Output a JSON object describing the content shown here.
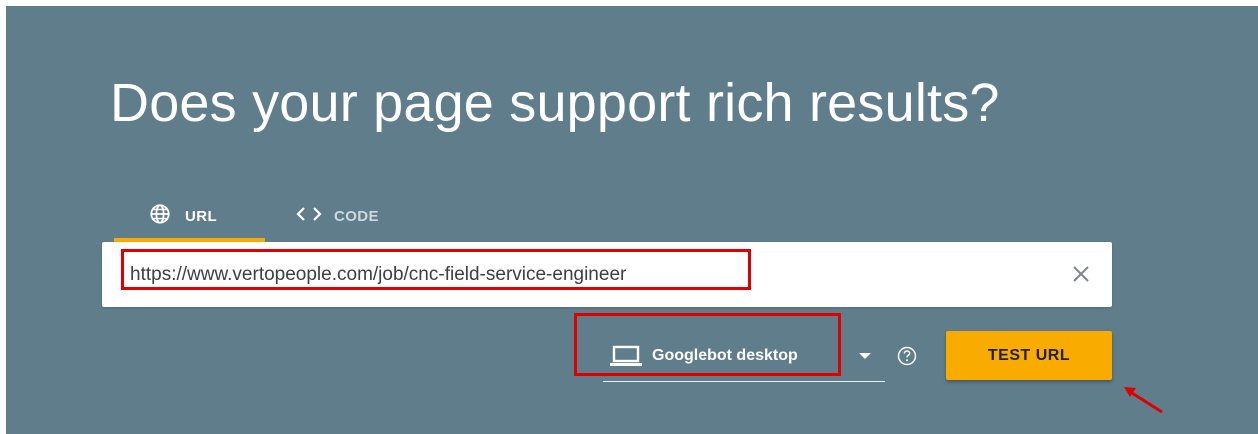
{
  "header": {
    "title": "Does your page support rich results?"
  },
  "tabs": [
    {
      "label": "URL",
      "icon": "globe-icon",
      "active": true
    },
    {
      "label": "CODE",
      "icon": "code-brackets-icon",
      "active": false
    }
  ],
  "url_input": {
    "value": "https://www.vertopeople.com/job/cnc-field-service-engineer",
    "clear_icon": "close-icon"
  },
  "device_select": {
    "selected": "Googlebot desktop",
    "icon": "laptop-icon"
  },
  "help_icon": "help-circle-icon",
  "test_button": {
    "label": "TEST URL"
  },
  "colors": {
    "panel_background": "#607d8b",
    "accent": "#f9ab00",
    "annotation_red": "#e00000"
  }
}
